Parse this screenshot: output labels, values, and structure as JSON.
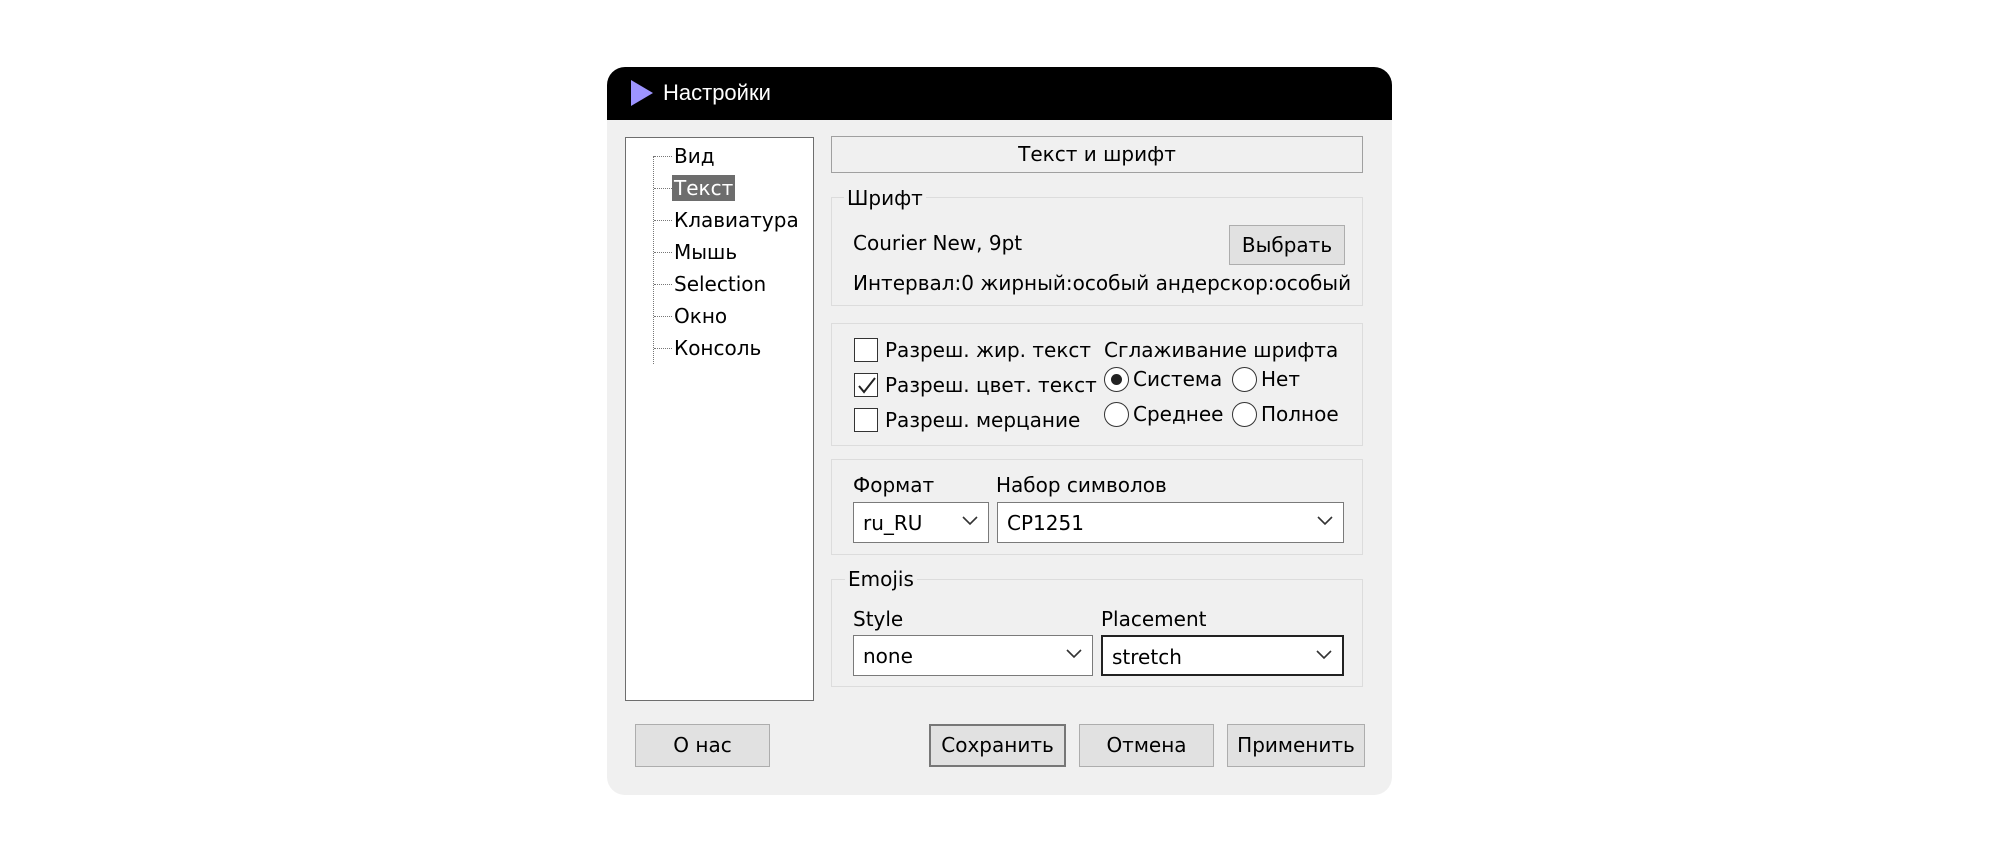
{
  "window": {
    "title": "Настройки"
  },
  "tree": {
    "items": [
      {
        "label": "Вид",
        "selected": false
      },
      {
        "label": "Текст",
        "selected": true
      },
      {
        "label": "Клавиатура",
        "selected": false
      },
      {
        "label": "Мышь",
        "selected": false
      },
      {
        "label": "Selection",
        "selected": false
      },
      {
        "label": "Окно",
        "selected": false
      },
      {
        "label": "Консоль",
        "selected": false
      }
    ]
  },
  "section_title": "Текст и шрифт",
  "font_group": {
    "legend": "Шрифт",
    "font_value": "Courier New, 9pt",
    "choose_button": "Выбрать",
    "details": "Интервал:0 жирный:особый андерскор:особый"
  },
  "text_options": {
    "checkboxes": [
      {
        "label": "Разреш. жир. текст",
        "checked": false
      },
      {
        "label": "Разреш. цвет. текст",
        "checked": true
      },
      {
        "label": "Разреш. мерцание",
        "checked": false
      }
    ],
    "smoothing_label": "Сглаживание шрифта",
    "smoothing_options": [
      {
        "label": "Система",
        "selected": true
      },
      {
        "label": "Нет",
        "selected": false
      },
      {
        "label": "Среднее",
        "selected": false
      },
      {
        "label": "Полное",
        "selected": false
      }
    ]
  },
  "locale_group": {
    "format_label": "Формат",
    "format_value": "ru_RU",
    "charset_label": "Набор символов",
    "charset_value": "CP1251"
  },
  "emoji_group": {
    "legend": "Emojis",
    "style_label": "Style",
    "style_value": "none",
    "placement_label": "Placement",
    "placement_value": "stretch"
  },
  "buttons": {
    "about": "О нас",
    "save": "Сохранить",
    "cancel": "Отмена",
    "apply": "Применить"
  },
  "colors": {
    "titlebar": "#000000",
    "title_icon": "#9d94ff",
    "dialog_bg": "#f0f0f0",
    "selection": "#6d6d6d"
  }
}
